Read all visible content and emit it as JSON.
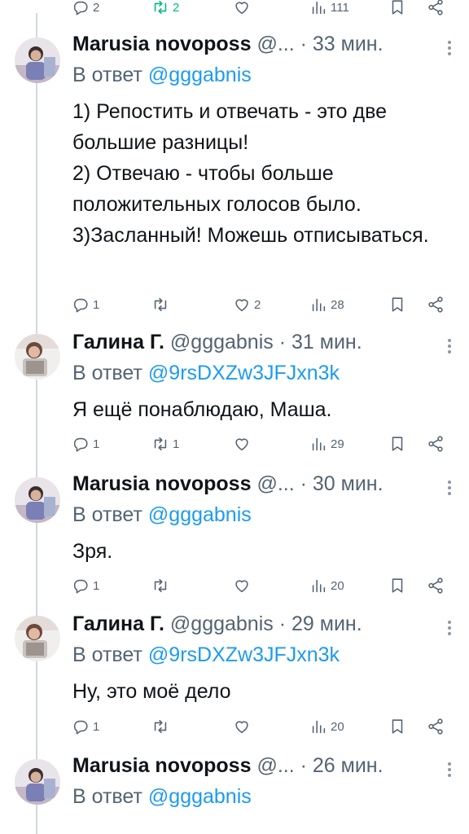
{
  "reply_label": "В ответ",
  "top_actions": {
    "replies": "2",
    "retweets": "2",
    "likes": "",
    "views": "111"
  },
  "tweets": [
    {
      "name": "Marusia novoposs",
      "handle": "@...",
      "time": "33 мин.",
      "reply_to": "@gggabnis",
      "text": "1) Репостить и отвечать - это две большие разницы!\n2) Отвечаю - чтобы больше положительных голосов было.\n3)Засланный! Можешь отписываться.",
      "replies": "1",
      "retweets": "",
      "likes": "2",
      "views": "28"
    },
    {
      "name": "Галина Г.",
      "handle": "@gggabnis",
      "time": "31 мин.",
      "reply_to": "@9rsDXZw3JFJxn3k",
      "text": "Я ещё понаблюдаю, Маша.",
      "replies": "1",
      "retweets": "1",
      "likes": "",
      "views": "29"
    },
    {
      "name": "Marusia novoposs",
      "handle": "@...",
      "time": "30 мин.",
      "reply_to": "@gggabnis",
      "text": "Зря.",
      "replies": "1",
      "retweets": "",
      "likes": "",
      "views": "20"
    },
    {
      "name": "Галина Г.",
      "handle": "@gggabnis",
      "time": "29 мин.",
      "reply_to": "@9rsDXZw3JFJxn3k",
      "text": "Ну, это моё дело",
      "replies": "1",
      "retweets": "",
      "likes": "",
      "views": "20"
    },
    {
      "name": "Marusia novoposs",
      "handle": "@...",
      "time": "26 мин.",
      "reply_to": "@gggabnis",
      "text": "",
      "replies": "",
      "retweets": "",
      "likes": "",
      "views": ""
    }
  ]
}
